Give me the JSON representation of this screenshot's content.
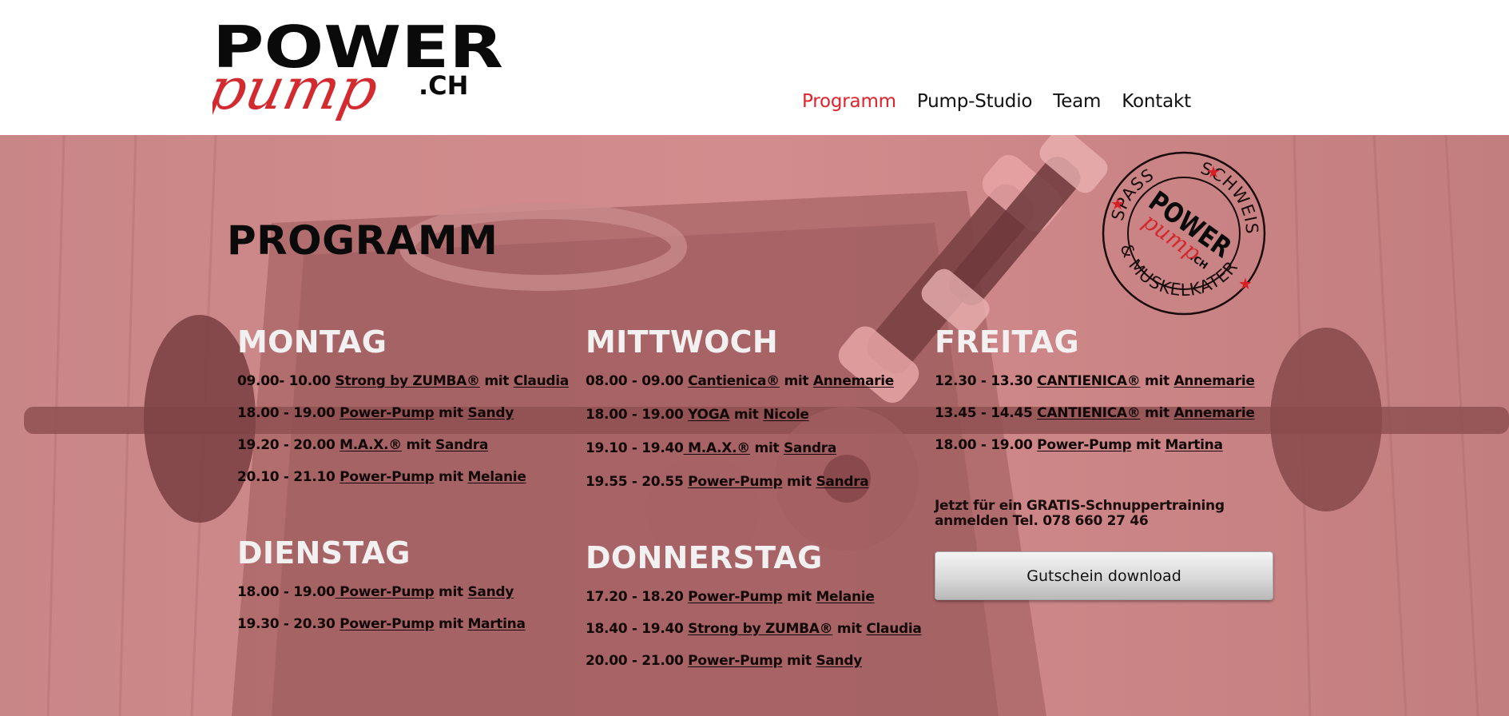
{
  "header": {
    "logo": {
      "word_top": "POWER",
      "word_script": "pump",
      "word_tld": ".CH"
    },
    "nav": [
      {
        "label": "Programm",
        "active": true
      },
      {
        "label": "Pump-Studio",
        "active": false
      },
      {
        "label": "Team",
        "active": false
      },
      {
        "label": "Kontakt",
        "active": false
      }
    ]
  },
  "colors": {
    "accent_red": "#e0222a",
    "overlay_pink": "#c27a7b",
    "day_heading": "#f2f0f0"
  },
  "main": {
    "title": "PROGRAMM",
    "badge": {
      "top_left_text": "SPASS",
      "top_right_text": "SCHWEISS",
      "bottom_text": "& MUSKELKATER",
      "center_top": "POWER",
      "center_script": "pump",
      "center_tld": ".CH"
    },
    "days": [
      {
        "name": "MONTAG",
        "classes": [
          {
            "time": "09.00- 10.00 ",
            "course": "Strong by ZUMBA®",
            "mit": " mit ",
            "trainer": "Claudia"
          },
          {
            "time": "18.00 - 19.00 ",
            "course": "Power-Pump",
            "mit": " mit ",
            "trainer": "Sandy"
          },
          {
            "time": "19.20 - 20.00 ",
            "course": "M.A.X.®",
            "mit": " mit ",
            "trainer": "Sandra"
          },
          {
            "time": "20.10 - 21.10 ",
            "course": "Power-Pump",
            "mit": " mit ",
            "trainer": "Melanie"
          }
        ]
      },
      {
        "name": "DIENSTAG",
        "classes": [
          {
            "time": "18.00 - 19.00",
            "course": " Power-Pump",
            "mit": " mit ",
            "trainer": "Sandy"
          },
          {
            "time": "19.30 - 20.30 ",
            "course": "Power-Pump",
            "mit": " mit ",
            "trainer": "Martina"
          }
        ]
      },
      {
        "name": "MITTWOCH",
        "classes": [
          {
            "time": "08.00 - 09.00 ",
            "course": "Cantienica®",
            "mit": " mit ",
            "trainer": "Annemarie"
          },
          {
            "time": "18.00 - 19.00 ",
            "course": "YOGA",
            "mit": " mit ",
            "trainer": "Nicole"
          },
          {
            "time": "19.10 - 19.40",
            "course": " M.A.X.®",
            "mit": " mit ",
            "trainer": "Sandra"
          },
          {
            "time": "19.55 - 20.55 ",
            "course": "Power-Pump",
            "mit": " mit ",
            "trainer": "Sandra"
          }
        ]
      },
      {
        "name": "DONNERSTAG",
        "classes": [
          {
            "time": "17.20 - 18.20 ",
            "course": "Power-Pump",
            "mit": " mit ",
            "trainer": "Melanie"
          },
          {
            "time": "18.40 - 19.40 ",
            "course": "Strong by ZUMBA®",
            "mit": " mit ",
            "trainer": "Claudia"
          },
          {
            "time": "20.00 - 21.00 ",
            "course": "Power-Pump",
            "mit": " mit ",
            "trainer": "Sandy"
          }
        ]
      },
      {
        "name": "FREITAG",
        "classes": [
          {
            "time": "12.30 - 13.30 ",
            "course": "CANTIENICA®",
            "mit": " mit ",
            "trainer": "Annemarie"
          },
          {
            "time": "13.45 - 14.45 ",
            "course": "CANTIENICA®",
            "mit": " mit ",
            "trainer": "Annemarie"
          },
          {
            "time": "18.00 - 19.00 ",
            "course": "Power-Pump",
            "mit": " mit ",
            "trainer": "Martina"
          }
        ]
      }
    ],
    "promo": {
      "line1": "Jetzt für ein GRATIS-Schnuppertraining",
      "line2": "anmelden Tel. 078 660 27 46"
    },
    "cta_label": "Gutschein download"
  }
}
